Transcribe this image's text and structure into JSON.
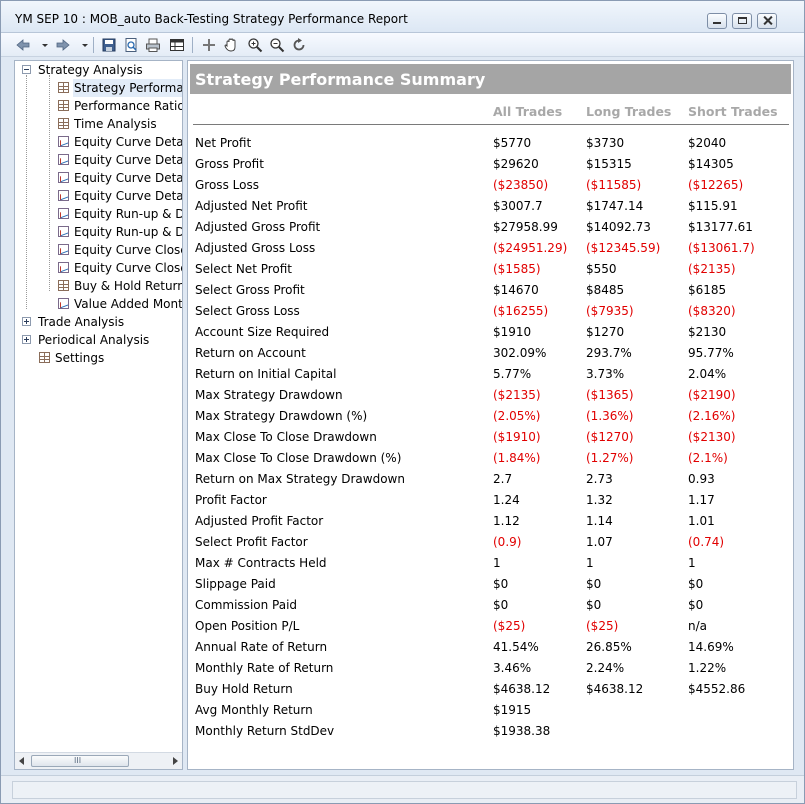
{
  "window": {
    "title": "YM   SEP 10 : MOB_auto Back-Testing Strategy Performance Report"
  },
  "toolbar": {
    "icons": [
      "back-arrow-icon",
      "dropdown-icon",
      "forward-arrow-icon",
      "dropdown-icon",
      "save-icon",
      "print-preview-icon",
      "print-icon",
      "table-view-icon",
      "crosshair-icon",
      "pan-hand-icon",
      "zoom-in-icon",
      "zoom-out-icon",
      "refresh-icon"
    ]
  },
  "tree": {
    "nodes": [
      {
        "label": "Strategy Analysis",
        "level": 0,
        "expander": "minus"
      },
      {
        "label": "Strategy Performanc",
        "level": 1,
        "icon": "table",
        "selected": true
      },
      {
        "label": "Performance Ratios",
        "level": 1,
        "icon": "table"
      },
      {
        "label": "Time Analysis",
        "level": 1,
        "icon": "table"
      },
      {
        "label": "Equity Curve Detaile",
        "level": 1,
        "icon": "graph"
      },
      {
        "label": "Equity Curve Detaile",
        "level": 1,
        "icon": "graph"
      },
      {
        "label": "Equity Curve Detaile",
        "level": 1,
        "icon": "graph"
      },
      {
        "label": "Equity Curve Detaile",
        "level": 1,
        "icon": "graph"
      },
      {
        "label": "Equity Run-up & Dra",
        "level": 1,
        "icon": "graph"
      },
      {
        "label": "Equity Run-up & Dra",
        "level": 1,
        "icon": "graph"
      },
      {
        "label": "Equity Curve Close T",
        "level": 1,
        "icon": "graph"
      },
      {
        "label": "Equity Curve Close T",
        "level": 1,
        "icon": "graph"
      },
      {
        "label": "Buy & Hold Return",
        "level": 1,
        "icon": "table"
      },
      {
        "label": "Value Added Month",
        "level": 1,
        "icon": "graph"
      },
      {
        "label": "Trade Analysis",
        "level": 0,
        "expander": "plus"
      },
      {
        "label": "Periodical Analysis",
        "level": 0,
        "expander": "plus"
      },
      {
        "label": "Settings",
        "level": 0,
        "icon": "table"
      }
    ],
    "scrollbar_glyph": "III"
  },
  "report": {
    "title": "Strategy Performance Summary",
    "columns": [
      "All Trades",
      "Long Trades",
      "Short Trades"
    ],
    "rows": [
      {
        "label": "Net Profit",
        "values": [
          "$5770",
          "$3730",
          "$2040"
        ],
        "neg": [
          false,
          false,
          false
        ]
      },
      {
        "label": "Gross Profit",
        "values": [
          "$29620",
          "$15315",
          "$14305"
        ],
        "neg": [
          false,
          false,
          false
        ]
      },
      {
        "label": "Gross Loss",
        "values": [
          "($23850)",
          "($11585)",
          "($12265)"
        ],
        "neg": [
          true,
          true,
          true
        ]
      },
      {
        "label": "Adjusted Net Profit",
        "values": [
          "$3007.7",
          "$1747.14",
          "$115.91"
        ],
        "neg": [
          false,
          false,
          false
        ]
      },
      {
        "label": "Adjusted Gross Profit",
        "values": [
          "$27958.99",
          "$14092.73",
          "$13177.61"
        ],
        "neg": [
          false,
          false,
          false
        ]
      },
      {
        "label": "Adjusted Gross Loss",
        "values": [
          "($24951.29)",
          "($12345.59)",
          "($13061.7)"
        ],
        "neg": [
          true,
          true,
          true
        ]
      },
      {
        "label": "Select Net Profit",
        "values": [
          "($1585)",
          "$550",
          "($2135)"
        ],
        "neg": [
          true,
          false,
          true
        ]
      },
      {
        "label": "Select Gross Profit",
        "values": [
          "$14670",
          "$8485",
          "$6185"
        ],
        "neg": [
          false,
          false,
          false
        ]
      },
      {
        "label": "Select Gross Loss",
        "values": [
          "($16255)",
          "($7935)",
          "($8320)"
        ],
        "neg": [
          true,
          true,
          true
        ]
      },
      {
        "label": "Account Size Required",
        "values": [
          "$1910",
          "$1270",
          "$2130"
        ],
        "neg": [
          false,
          false,
          false
        ]
      },
      {
        "label": "Return on Account",
        "values": [
          "302.09%",
          "293.7%",
          "95.77%"
        ],
        "neg": [
          false,
          false,
          false
        ]
      },
      {
        "label": "Return on Initial Capital",
        "values": [
          "5.77%",
          "3.73%",
          "2.04%"
        ],
        "neg": [
          false,
          false,
          false
        ]
      },
      {
        "label": "Max Strategy Drawdown",
        "values": [
          "($2135)",
          "($1365)",
          "($2190)"
        ],
        "neg": [
          true,
          true,
          true
        ]
      },
      {
        "label": "Max Strategy Drawdown (%)",
        "values": [
          "(2.05%)",
          "(1.36%)",
          "(2.16%)"
        ],
        "neg": [
          true,
          true,
          true
        ]
      },
      {
        "label": "Max Close To Close Drawdown",
        "values": [
          "($1910)",
          "($1270)",
          "($2130)"
        ],
        "neg": [
          true,
          true,
          true
        ]
      },
      {
        "label": "Max Close To Close Drawdown (%)",
        "values": [
          "(1.84%)",
          "(1.27%)",
          "(2.1%)"
        ],
        "neg": [
          true,
          true,
          true
        ]
      },
      {
        "label": "Return on Max Strategy Drawdown",
        "values": [
          "2.7",
          "2.73",
          "0.93"
        ],
        "neg": [
          false,
          false,
          false
        ]
      },
      {
        "label": "Profit Factor",
        "values": [
          "1.24",
          "1.32",
          "1.17"
        ],
        "neg": [
          false,
          false,
          false
        ]
      },
      {
        "label": "Adjusted Profit Factor",
        "values": [
          "1.12",
          "1.14",
          "1.01"
        ],
        "neg": [
          false,
          false,
          false
        ]
      },
      {
        "label": "Select Profit Factor",
        "values": [
          "(0.9)",
          "1.07",
          "(0.74)"
        ],
        "neg": [
          true,
          false,
          true
        ]
      },
      {
        "label": "Max # Contracts Held",
        "values": [
          "1",
          "1",
          "1"
        ],
        "neg": [
          false,
          false,
          false
        ]
      },
      {
        "label": "Slippage Paid",
        "values": [
          "$0",
          "$0",
          "$0"
        ],
        "neg": [
          false,
          false,
          false
        ]
      },
      {
        "label": "Commission Paid",
        "values": [
          "$0",
          "$0",
          "$0"
        ],
        "neg": [
          false,
          false,
          false
        ]
      },
      {
        "label": "Open Position P/L",
        "values": [
          "($25)",
          "($25)",
          "n/a"
        ],
        "neg": [
          true,
          true,
          false
        ]
      },
      {
        "label": "Annual Rate of Return",
        "values": [
          "41.54%",
          "26.85%",
          "14.69%"
        ],
        "neg": [
          false,
          false,
          false
        ]
      },
      {
        "label": "Monthly Rate of Return",
        "values": [
          "3.46%",
          "2.24%",
          "1.22%"
        ],
        "neg": [
          false,
          false,
          false
        ]
      },
      {
        "label": "Buy  Hold Return",
        "values": [
          "$4638.12",
          "$4638.12",
          "$4552.86"
        ],
        "neg": [
          false,
          false,
          false
        ]
      },
      {
        "label": "Avg Monthly Return",
        "values": [
          "$1915",
          "",
          ""
        ],
        "neg": [
          false,
          false,
          false
        ]
      },
      {
        "label": "Monthly Return StdDev",
        "values": [
          "$1938.38",
          "",
          ""
        ],
        "neg": [
          false,
          false,
          false
        ]
      }
    ]
  },
  "colors": {
    "negative": "#e10000",
    "header_band": "#a5a5a5",
    "column_header": "#a8a8a8"
  }
}
